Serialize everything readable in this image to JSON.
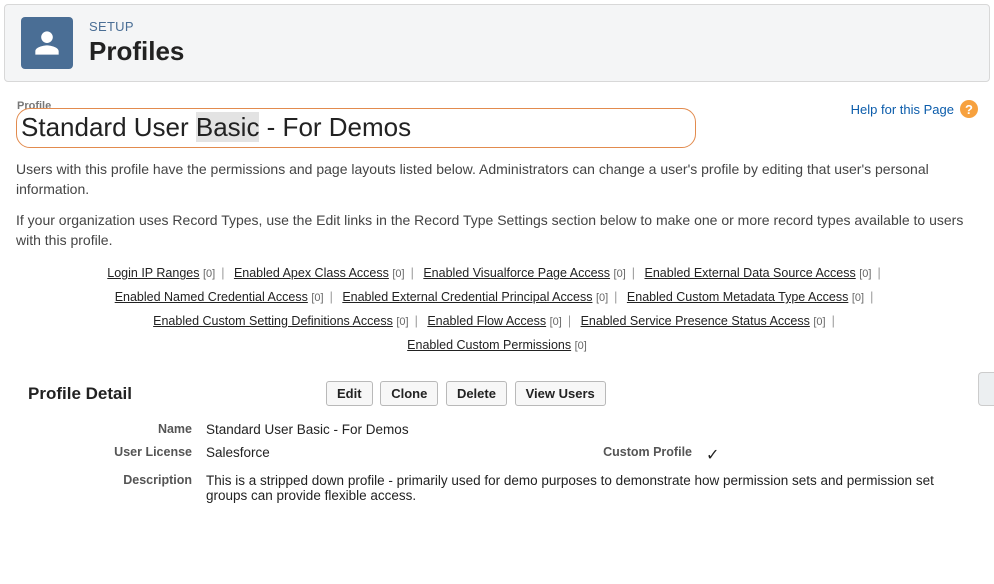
{
  "header": {
    "eyebrow": "SETUP",
    "title": "Profiles"
  },
  "profile": {
    "smallLabel": "Profile",
    "namePrefix": "Standard User ",
    "nameHighlight": "Basic",
    "nameSuffix": " - For Demos"
  },
  "help": {
    "text": "Help for this Page",
    "iconChar": "?"
  },
  "para1": "Users with this profile have the permissions and page layouts listed below. Administrators can change a user's profile by editing that user's personal information.",
  "para2": "If your organization uses Record Types, use the Edit links in the Record Type Settings section below to make one or more record types available to users with this profile.",
  "quickLinks": [
    {
      "label": "Login IP Ranges",
      "count": "[0]"
    },
    {
      "label": "Enabled Apex Class Access",
      "count": "[0]"
    },
    {
      "label": "Enabled Visualforce Page Access",
      "count": "[0]"
    },
    {
      "label": "Enabled External Data Source Access",
      "count": "[0]"
    },
    {
      "label": "Enabled Named Credential Access",
      "count": "[0]"
    },
    {
      "label": "Enabled External Credential Principal Access",
      "count": "[0]"
    },
    {
      "label": "Enabled Custom Metadata Type Access",
      "count": "[0]"
    },
    {
      "label": "Enabled Custom Setting Definitions Access",
      "count": "[0]"
    },
    {
      "label": "Enabled Flow Access",
      "count": "[0]"
    },
    {
      "label": "Enabled Service Presence Status Access",
      "count": "[0]"
    },
    {
      "label": "Enabled Custom Permissions",
      "count": "[0]"
    }
  ],
  "detail": {
    "heading": "Profile Detail",
    "buttons": {
      "edit": "Edit",
      "clone": "Clone",
      "delete": "Delete",
      "viewUsers": "View Users"
    },
    "rows": {
      "nameLabel": "Name",
      "nameValue": "Standard User Basic - For Demos",
      "licenseLabel": "User License",
      "licenseValue": "Salesforce",
      "customLabel": "Custom Profile",
      "customValue": "✓",
      "descLabel": "Description",
      "descValue": "This is a stripped down profile - primarily used for demo purposes to demonstrate how permission sets and permission set groups can provide flexible access."
    }
  }
}
